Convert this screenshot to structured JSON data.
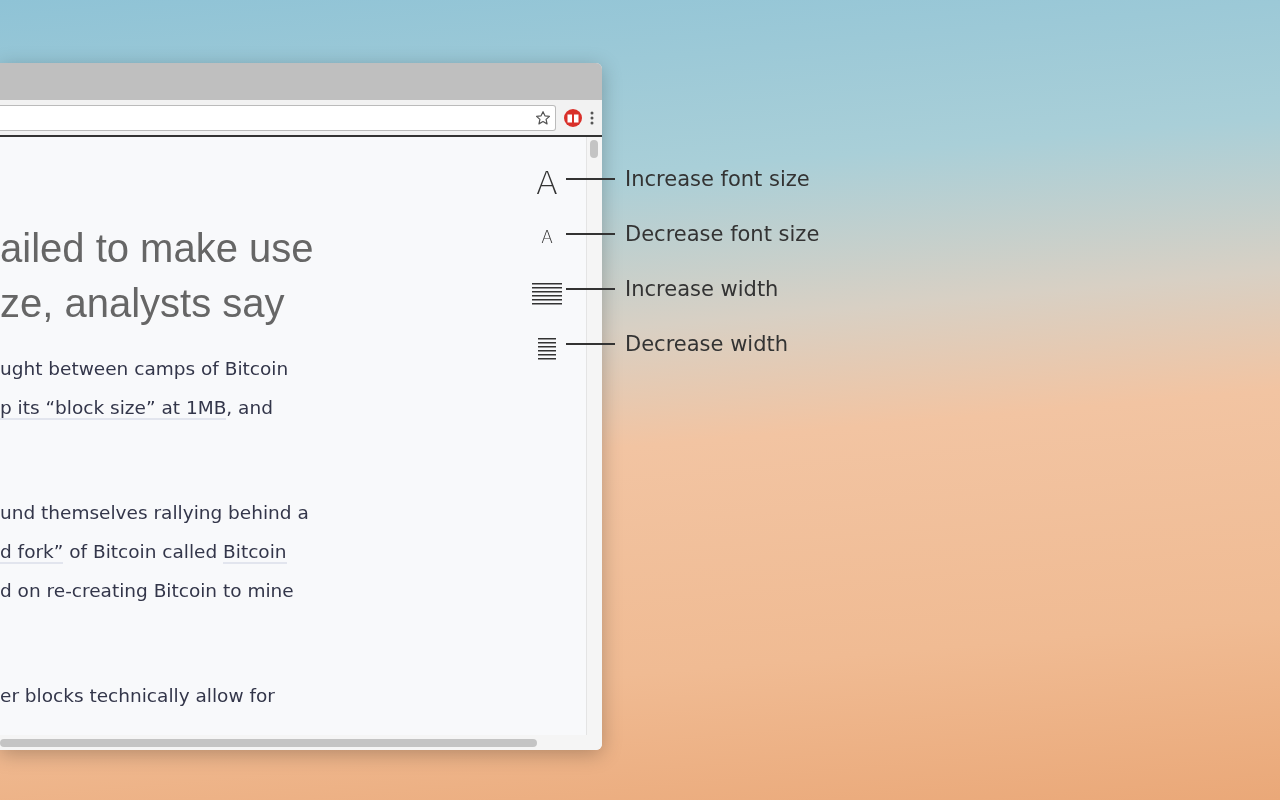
{
  "reader_controls": [
    {
      "kind": "fontlarge",
      "glyph": "A",
      "label": "Increase font size"
    },
    {
      "kind": "fontsmall",
      "glyph": "A",
      "label": "Decrease font size"
    },
    {
      "kind": "widthlarge",
      "label": "Increase width"
    },
    {
      "kind": "widthsmall",
      "label": "Decrease width"
    }
  ],
  "article": {
    "headline": [
      "ailed to make use",
      "ze, analysts say"
    ],
    "paragraphs": [
      {
        "lines": [
          [
            {
              "text": "ught between camps of Bitcoin",
              "link": false
            }
          ],
          [
            {
              "text": "p its “block size” at 1MB",
              "link": true
            },
            {
              "text": ", and",
              "link": false
            }
          ]
        ]
      },
      {
        "lines": [
          [
            {
              "text": "und themselves rallying behind a",
              "link": false
            }
          ],
          [
            {
              "text": "d fork”",
              "link": true
            },
            {
              "text": " of Bitcoin called ",
              "link": false
            },
            {
              "text": "Bitcoin",
              "link": true
            }
          ],
          [
            {
              "text": "d on re-creating Bitcoin to mine",
              "link": false
            }
          ]
        ]
      },
      {
        "lines": [
          [
            {
              "text": "er blocks technically allow for",
              "link": false
            }
          ]
        ]
      }
    ]
  }
}
